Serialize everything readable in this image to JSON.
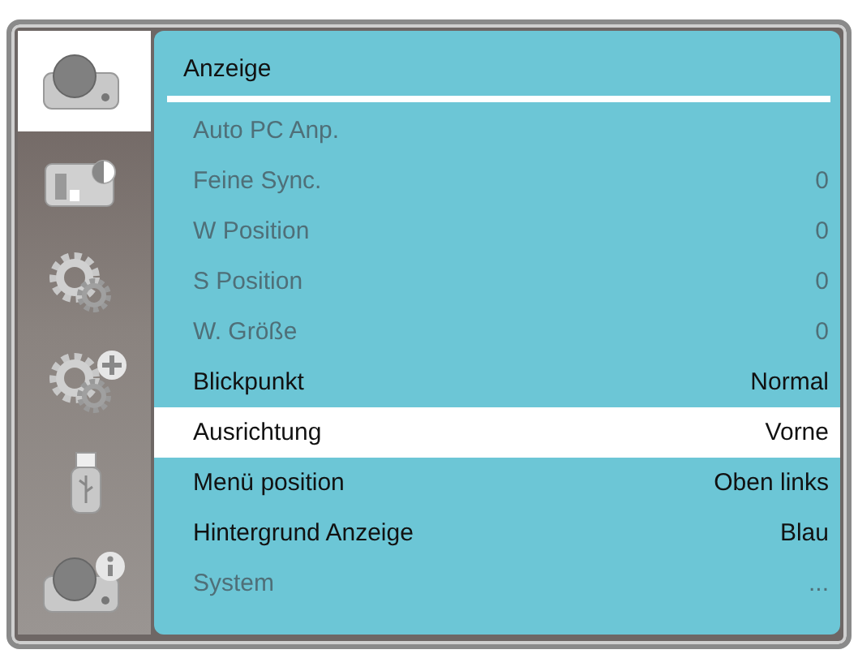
{
  "menu_tabs": [
    {
      "kind": "projector",
      "selected": true
    },
    {
      "kind": "picture",
      "selected": false
    },
    {
      "kind": "gears",
      "selected": false
    },
    {
      "kind": "gears-plus",
      "selected": false
    },
    {
      "kind": "usb",
      "selected": false
    },
    {
      "kind": "projector-info",
      "selected": false
    }
  ],
  "panel": {
    "title": "Anzeige"
  },
  "rows": [
    {
      "label": "Auto PC Anp.",
      "disabled": true,
      "selected": false
    },
    {
      "label": "Feine Sync.",
      "value": "0",
      "disabled": true,
      "selected": false
    },
    {
      "label": "W Position",
      "value": "0",
      "disabled": true,
      "selected": false
    },
    {
      "label": "S Position",
      "value": "0",
      "disabled": true,
      "selected": false
    },
    {
      "label": "W. Größe",
      "value": "0",
      "disabled": true,
      "selected": false
    },
    {
      "label": "Blickpunkt",
      "value": "Normal",
      "disabled": false,
      "selected": false
    },
    {
      "label": "Ausrichtung",
      "value": "Vorne",
      "disabled": false,
      "selected": true
    },
    {
      "label": "Menü position",
      "value": "Oben links",
      "disabled": false,
      "selected": false
    },
    {
      "label": "Hintergrund Anzeige",
      "value": "Blau",
      "disabled": false,
      "selected": false
    },
    {
      "label": "System",
      "value": "...",
      "disabled": true,
      "selected": false
    }
  ]
}
